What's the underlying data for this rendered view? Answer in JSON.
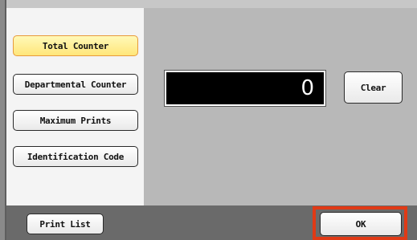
{
  "left_panel": {
    "items": [
      {
        "label": "Total Counter",
        "selected": true
      },
      {
        "label": "Departmental Counter",
        "selected": false
      },
      {
        "label": "Maximum Prints",
        "selected": false
      },
      {
        "label": "Identification Code",
        "selected": false
      }
    ]
  },
  "display": {
    "value": "0"
  },
  "buttons": {
    "clear": "Clear",
    "print_list": "Print List",
    "ok": "OK"
  },
  "colors": {
    "selected_fill": "#ffe67a",
    "selected_border": "#e89a3a",
    "ok_highlight": "#e03a16",
    "display_bg": "#000000",
    "right_panel_bg": "#b8b8b8",
    "bottom_bar_bg": "#6a6a6a"
  }
}
